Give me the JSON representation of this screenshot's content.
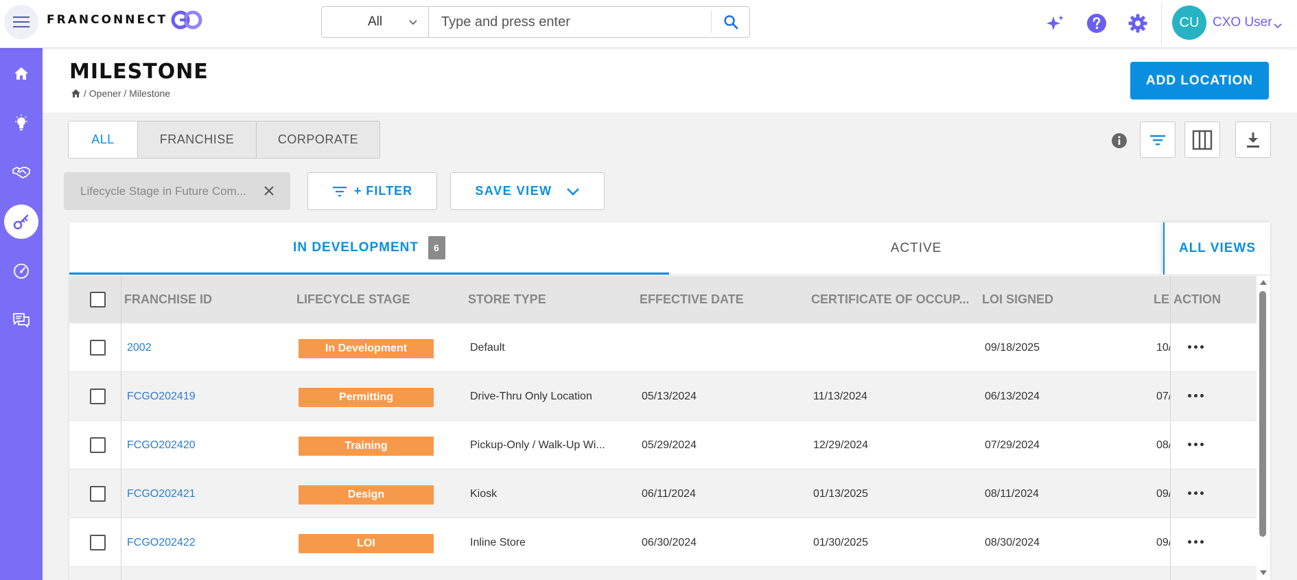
{
  "topbar": {
    "logo_text": "FRANCONNECT",
    "search_scope": "All",
    "search_placeholder": "Type and press enter",
    "user_initials": "CU",
    "user_name": "CXO User"
  },
  "page": {
    "title": "MILESTONE",
    "breadcrumb": "/ Opener / Milestone",
    "add_button": "ADD LOCATION"
  },
  "segments": [
    "ALL",
    "FRANCHISE",
    "CORPORATE"
  ],
  "filters": {
    "chip_label": "Lifecycle Stage in Future Com...",
    "filter_button": "+ FILTER",
    "save_view_button": "SAVE VIEW"
  },
  "view_tabs": {
    "in_development": "IN DEVELOPMENT",
    "in_development_count": "6",
    "active": "ACTIVE",
    "all_views": "ALL VIEWS"
  },
  "table": {
    "headers": {
      "franchise_id": "FRANCHISE ID",
      "lifecycle_stage": "LIFECYCLE STAGE",
      "store_type": "STORE TYPE",
      "effective_date": "EFFECTIVE DATE",
      "certificate": "CERTIFICATE OF OCCUP...",
      "loi_signed": "LOI SIGNED",
      "lease": "LE",
      "action": "ACTION"
    },
    "rows": [
      {
        "id": "2002",
        "stage": "In Development",
        "store_type": "Default",
        "effective": "",
        "certificate": "",
        "loi": "09/18/2025",
        "lease": "10/"
      },
      {
        "id": "FCGO202419",
        "stage": "Permitting",
        "store_type": "Drive-Thru Only Location",
        "effective": "05/13/2024",
        "certificate": "11/13/2024",
        "loi": "06/13/2024",
        "lease": "07/"
      },
      {
        "id": "FCGO202420",
        "stage": "Training",
        "store_type": "Pickup-Only / Walk-Up Wi...",
        "effective": "05/29/2024",
        "certificate": "12/29/2024",
        "loi": "07/29/2024",
        "lease": "08/"
      },
      {
        "id": "FCGO202421",
        "stage": "Design",
        "store_type": "Kiosk",
        "effective": "06/11/2024",
        "certificate": "01/13/2025",
        "loi": "08/11/2024",
        "lease": "09/"
      },
      {
        "id": "FCGO202422",
        "stage": "LOI",
        "store_type": "Inline Store",
        "effective": "06/30/2024",
        "certificate": "01/30/2025",
        "loi": "08/30/2024",
        "lease": "09/"
      }
    ]
  },
  "colors": {
    "accent": "#0a8fe0",
    "sidebar": "#7b6ef6",
    "stage_badge": "#f7994a",
    "brand_purple": "#6a5ff0"
  }
}
